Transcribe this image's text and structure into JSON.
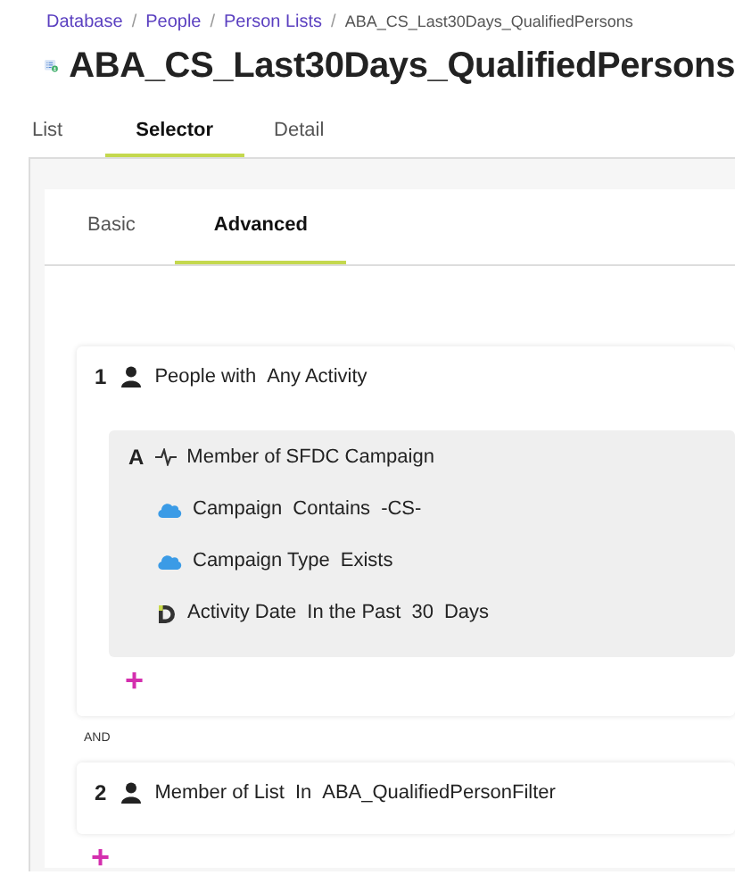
{
  "breadcrumbs": [
    {
      "label": "Database",
      "kind": "link"
    },
    {
      "label": "People",
      "kind": "link"
    },
    {
      "label": "Person Lists",
      "kind": "link"
    },
    {
      "label": "ABA_CS_Last30Days_QualifiedPersons",
      "kind": "current"
    }
  ],
  "title": "ABA_CS_Last30Days_QualifiedPersons",
  "tabs": [
    {
      "label": "List",
      "selected": false
    },
    {
      "label": "Selector",
      "selected": true
    },
    {
      "label": "Detail",
      "selected": false
    }
  ],
  "subtabs": [
    {
      "label": "Basic",
      "selected": false
    },
    {
      "label": "Advanced",
      "selected": true
    }
  ],
  "filters": [
    {
      "number": "1",
      "parts": [
        "People with",
        "Any Activity"
      ],
      "conditions": [
        {
          "letter": "A",
          "parts": [
            "Member of SFDC Campaign"
          ],
          "constraints": [
            {
              "kind": "cloud",
              "parts": [
                "Campaign",
                "Contains",
                "-CS-"
              ]
            },
            {
              "kind": "cloud",
              "parts": [
                "Campaign Type",
                "Exists"
              ]
            },
            {
              "kind": "date",
              "parts": [
                "Activity Date",
                "In the Past",
                "30",
                "Days"
              ]
            }
          ]
        }
      ],
      "add_button": "+"
    },
    {
      "number": "2",
      "parts": [
        "Member of List",
        "In",
        "ABA_QualifiedPersonFilter"
      ]
    }
  ],
  "breadcrumb_separator": "/",
  "connector": "AND",
  "add_button": "+"
}
